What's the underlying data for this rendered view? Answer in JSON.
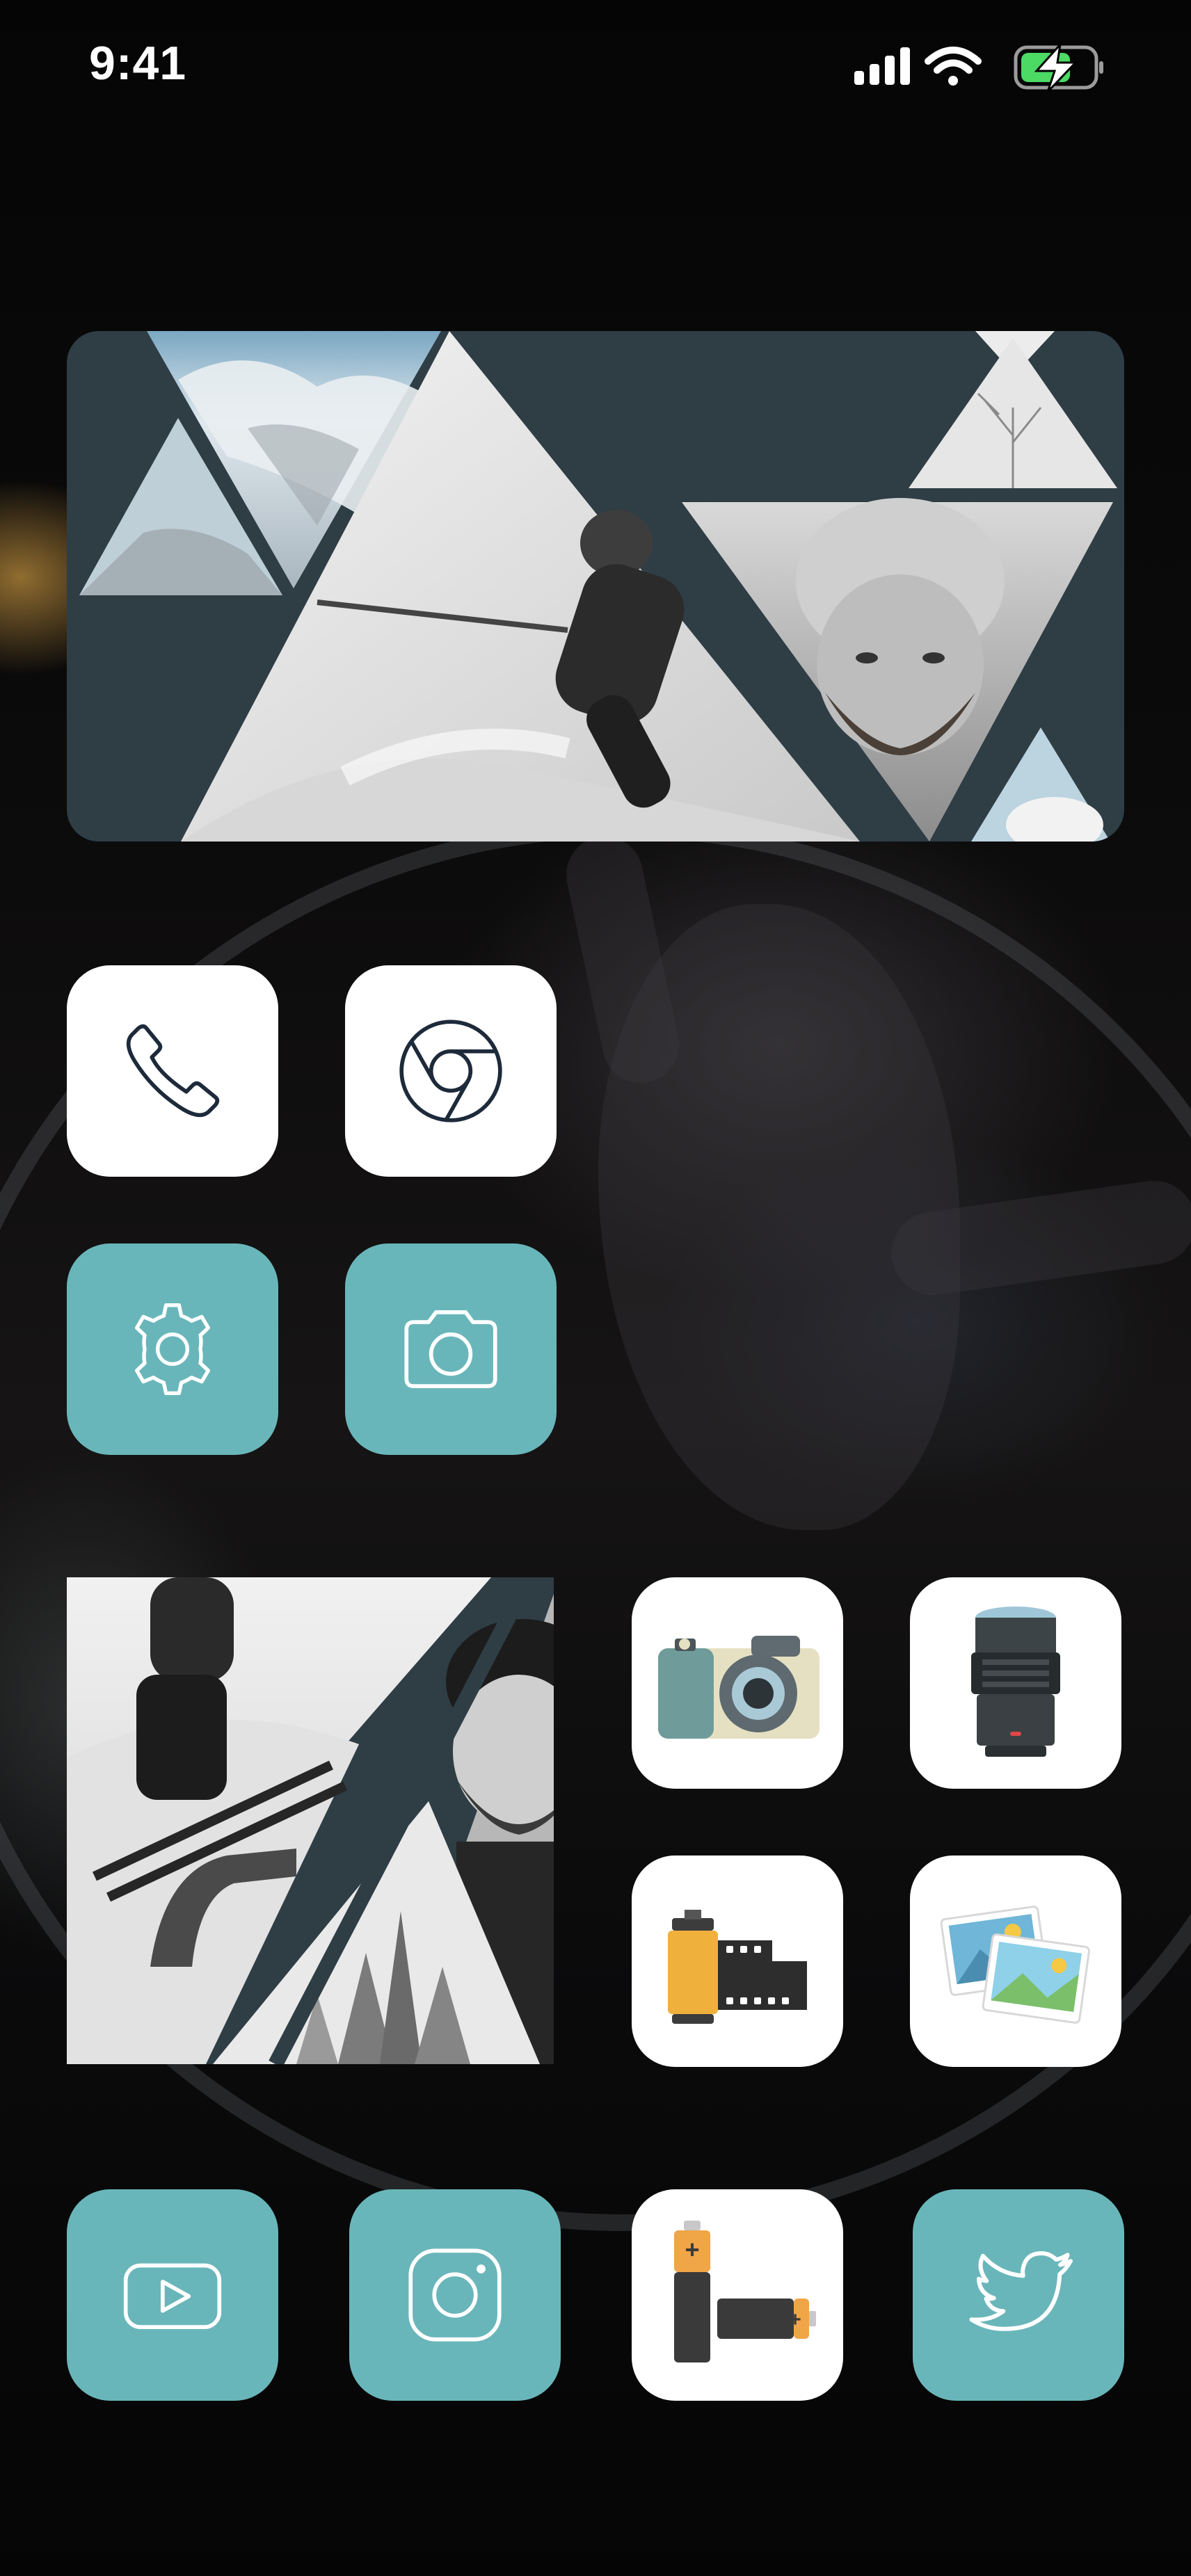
{
  "status_bar": {
    "time": "9:41",
    "icons": [
      "cellular-signal-icon",
      "wifi-icon",
      "battery-charging-icon"
    ]
  },
  "colors": {
    "widget_background": "#2f3d45",
    "teal_icon": "#69b6ba",
    "white_icon": "#ffffff",
    "battery_green": "#4cd964"
  },
  "widgets": [
    {
      "name": "photo-collage-widget-large",
      "content": "mountain and skier triangle collage"
    },
    {
      "name": "photo-collage-widget-small",
      "content": "skier, man and forest triangle collage"
    }
  ],
  "apps": {
    "row1": [
      {
        "name": "phone-app",
        "icon": "phone-icon",
        "style": "white"
      },
      {
        "name": "chrome-app",
        "icon": "chrome-icon",
        "style": "white"
      }
    ],
    "row2": [
      {
        "name": "settings-app",
        "icon": "gear-icon",
        "style": "teal"
      },
      {
        "name": "camera-app",
        "icon": "camera-icon",
        "style": "teal"
      }
    ],
    "grid_right": [
      {
        "name": "retro-camera-app",
        "icon": "retro-camera-icon",
        "style": "white"
      },
      {
        "name": "lens-app",
        "icon": "camera-lens-icon",
        "style": "white"
      },
      {
        "name": "film-roll-app",
        "icon": "film-roll-icon",
        "style": "white"
      },
      {
        "name": "photos-app",
        "icon": "photos-icon",
        "style": "white"
      }
    ],
    "dock": [
      {
        "name": "youtube-app",
        "icon": "play-icon",
        "style": "teal"
      },
      {
        "name": "instagram-app",
        "icon": "instagram-icon",
        "style": "teal"
      },
      {
        "name": "batteries-app",
        "icon": "batteries-icon",
        "style": "white"
      },
      {
        "name": "twitter-app",
        "icon": "bird-icon",
        "style": "teal"
      }
    ]
  }
}
